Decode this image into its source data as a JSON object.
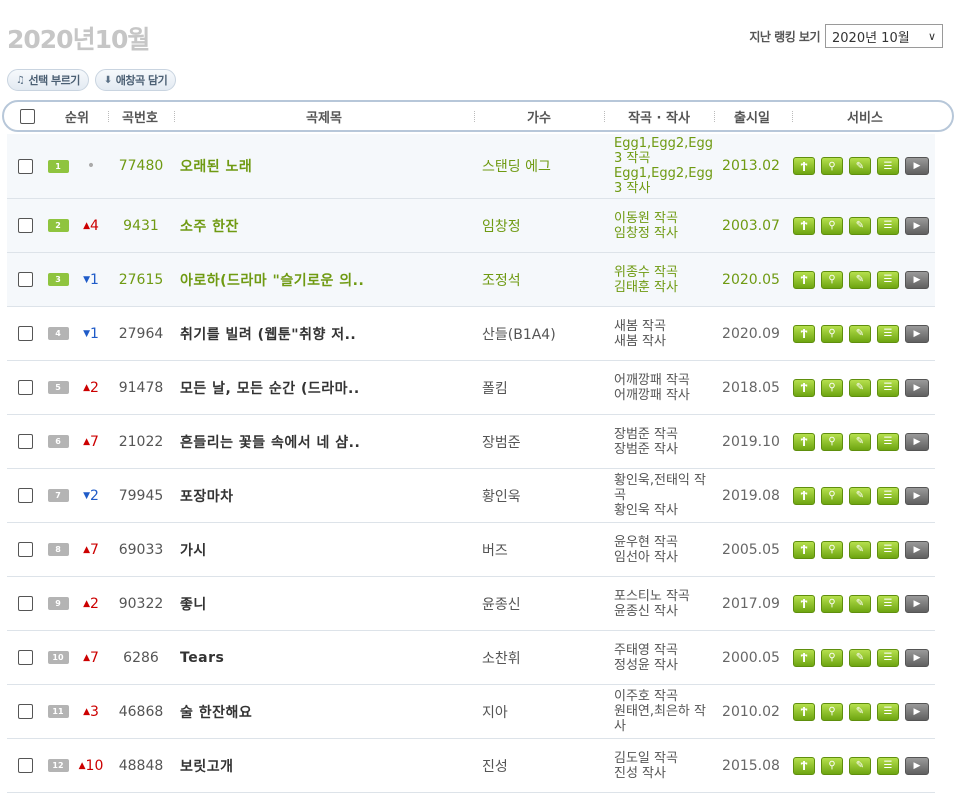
{
  "header": {
    "title": "2020년10월",
    "past_label": "지난 랭킹 보기",
    "past_select": "2020년 10월"
  },
  "toolbar": {
    "select_call": "선택 부르기",
    "add_favorite": "애창곡 담기"
  },
  "columns": {
    "rank": "순위",
    "number": "곡번호",
    "title": "곡제목",
    "artist": "가수",
    "credit": "작곡 · 작사",
    "release": "출시일",
    "service": "서비스"
  },
  "rows": [
    {
      "rank": "1",
      "change": "•",
      "dir": "same",
      "no": "77480",
      "title": "오래된 노래",
      "artist": "스탠딩 에그",
      "credit1": "Egg1,Egg2,Egg3 작곡",
      "credit2": "Egg1,Egg2,Egg3 작사",
      "date": "2013.02"
    },
    {
      "rank": "2",
      "change": "4",
      "dir": "up",
      "no": "9431",
      "title": "소주 한잔",
      "artist": "임창정",
      "credit1": "이동원 작곡",
      "credit2": "임창정 작사",
      "date": "2003.07"
    },
    {
      "rank": "3",
      "change": "1",
      "dir": "down",
      "no": "27615",
      "title": "아로하(드라마 \"슬기로운 의..",
      "artist": "조정석",
      "credit1": "위종수 작곡",
      "credit2": "김태훈 작사",
      "date": "2020.05"
    },
    {
      "rank": "4",
      "change": "1",
      "dir": "down",
      "no": "27964",
      "title": "취기를 빌려 (웹툰\"취향 저..",
      "artist": "산들(B1A4)",
      "credit1": "새봄 작곡",
      "credit2": "새봄 작사",
      "date": "2020.09"
    },
    {
      "rank": "5",
      "change": "2",
      "dir": "up",
      "no": "91478",
      "title": "모든 날, 모든 순간 (드라마..",
      "artist": "폴킴",
      "credit1": "어깨깡패 작곡",
      "credit2": "어깨깡패 작사",
      "date": "2018.05"
    },
    {
      "rank": "6",
      "change": "7",
      "dir": "up",
      "no": "21022",
      "title": "흔들리는 꽃들 속에서 네 샴..",
      "artist": "장범준",
      "credit1": "장범준 작곡",
      "credit2": "장범준 작사",
      "date": "2019.10"
    },
    {
      "rank": "7",
      "change": "2",
      "dir": "down",
      "no": "79945",
      "title": "포장마차",
      "artist": "황인욱",
      "credit1": "황인욱,전태익 작곡",
      "credit2": "황인욱 작사",
      "date": "2019.08"
    },
    {
      "rank": "8",
      "change": "7",
      "dir": "up",
      "no": "69033",
      "title": "가시",
      "artist": "버즈",
      "credit1": "윤우현 작곡",
      "credit2": "임선아 작사",
      "date": "2005.05"
    },
    {
      "rank": "9",
      "change": "2",
      "dir": "up",
      "no": "90322",
      "title": "좋니",
      "artist": "윤종신",
      "credit1": "포스티노 작곡",
      "credit2": "윤종신 작사",
      "date": "2017.09"
    },
    {
      "rank": "10",
      "change": "7",
      "dir": "up",
      "no": "6286",
      "title": "Tears",
      "artist": "소찬휘",
      "credit1": "주태영 작곡",
      "credit2": "정성윤 작사",
      "date": "2000.05"
    },
    {
      "rank": "11",
      "change": "3",
      "dir": "up",
      "no": "46868",
      "title": "술 한잔해요",
      "artist": "지아",
      "credit1": "이주호 작곡",
      "credit2": "원태연,최은하 작사",
      "date": "2010.02"
    },
    {
      "rank": "12",
      "change": "10",
      "dir": "up",
      "no": "48848",
      "title": "보릿고개",
      "artist": "진성",
      "credit1": "김도일 작곡",
      "credit2": "진성 작사",
      "date": "2015.08"
    }
  ],
  "icons": {
    "up": "▲",
    "down": "▼"
  }
}
